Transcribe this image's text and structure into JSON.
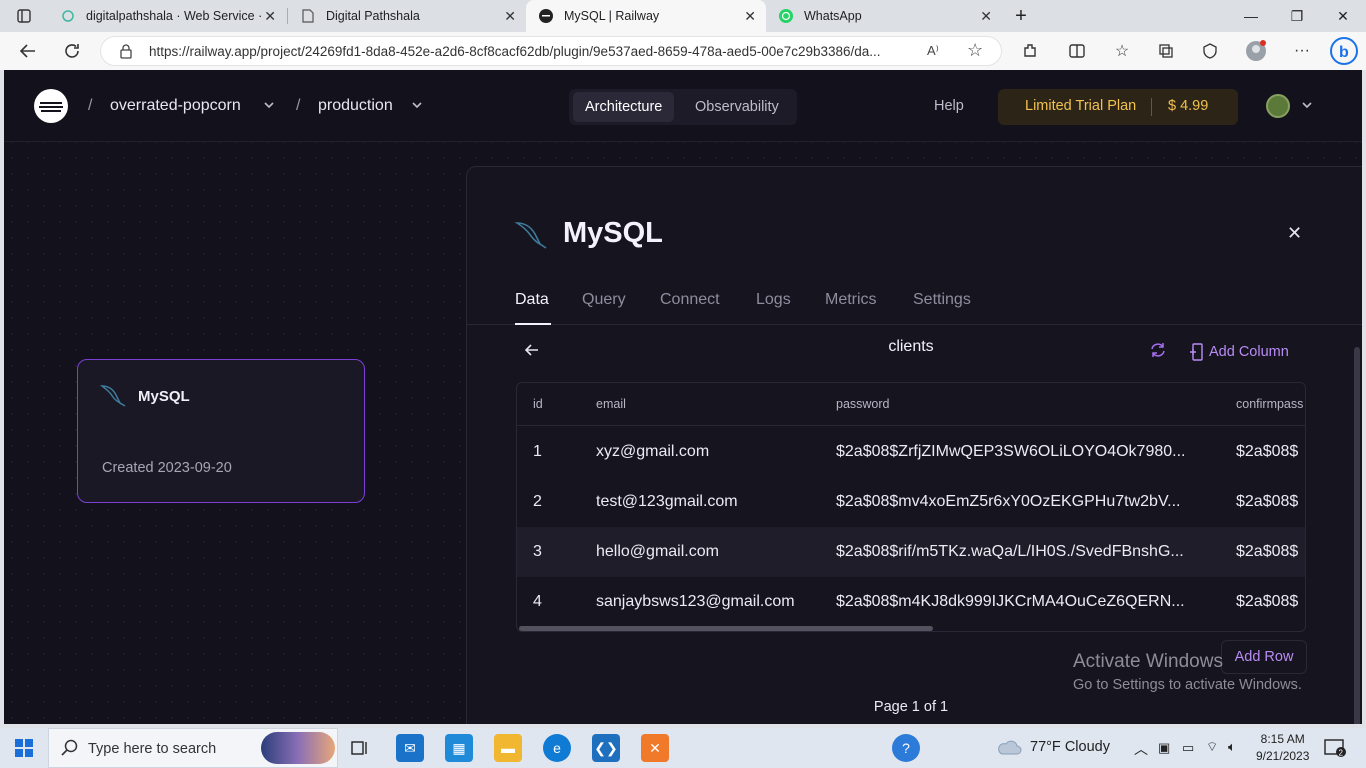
{
  "browser": {
    "tabs": [
      {
        "title": "digitalpathshala · Web Service ·"
      },
      {
        "title": "Digital Pathshala"
      },
      {
        "title": "MySQL | Railway"
      },
      {
        "title": "WhatsApp"
      }
    ],
    "url": "https://railway.app/project/24269fd1-8da8-452e-a2d6-8cf8cacf62db/plugin/9e537aed-8659-478a-aed5-00e7c29b3386/da..."
  },
  "nav": {
    "project": "overrated-popcorn",
    "environment": "production",
    "views": [
      "Architecture",
      "Observability"
    ],
    "help": "Help",
    "plan_label": "Limited Trial Plan",
    "plan_amount": "$ 4.99"
  },
  "service_card": {
    "name": "MySQL",
    "created": "Created 2023-09-20"
  },
  "panel": {
    "title": "MySQL",
    "tabs": [
      "Data",
      "Query",
      "Connect",
      "Logs",
      "Metrics",
      "Settings"
    ],
    "table_name": "clients",
    "add_column": "Add Column",
    "columns": [
      "id",
      "email",
      "password",
      "confirmpass"
    ],
    "rows": [
      [
        "1",
        "xyz@gmail.com",
        "$2a$08$ZrfjZIMwQEP3SW6OLiLOYO4Ok7980...",
        "$2a$08$"
      ],
      [
        "2",
        "test@123gmail.com",
        "$2a$08$mv4xoEmZ5r6xY0OzEKGPHu7tw2bV...",
        "$2a$08$"
      ],
      [
        "3",
        "hello@gmail.com",
        "$2a$08$rif/m5TKz.waQa/L/IH0S./SvedFBnshG...",
        "$2a$08$"
      ],
      [
        "4",
        "sanjaybsws123@gmail.com",
        "$2a$08$m4KJ8dk999IJKCrMA4OuCeZ6QERN...",
        "$2a$08$"
      ]
    ],
    "add_row": "Add Row",
    "page_info": "Page 1 of 1"
  },
  "watermark": {
    "line1": "Activate Windows",
    "line2": "Go to Settings to activate Windows."
  },
  "taskbar": {
    "search_placeholder": "Type here to search",
    "weather": "77°F  Cloudy",
    "time": "8:15 AM",
    "date": "9/21/2023"
  },
  "colors": {
    "accent": "#a66ef0",
    "trial": "#f2c14e",
    "background": "#13111c"
  }
}
